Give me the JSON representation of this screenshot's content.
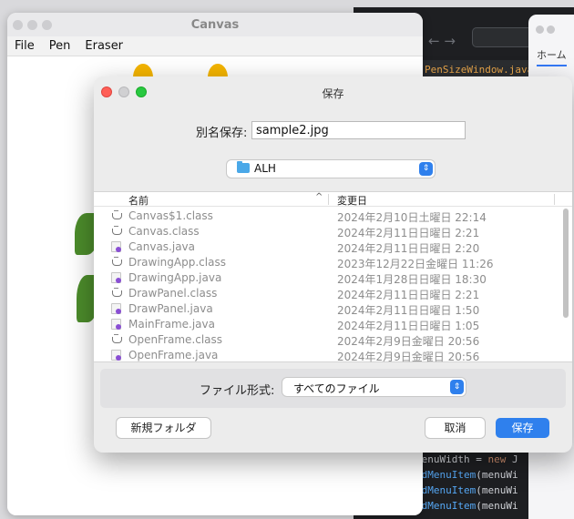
{
  "editor": {
    "nav_arrows": "← →",
    "tab_label": "PenSizeWindow.java",
    "code_lines": [
      {
        "a": "menuWidth = ",
        "kw": "new",
        "b": " J"
      },
      {
        "a": "",
        "m": "ddMenuItem",
        "b": "(menuWi"
      },
      {
        "a": "",
        "m": "ddMenuItem",
        "b": "(menuWi"
      },
      {
        "a": "",
        "m": "ddMenuItem",
        "b": "(menuWi"
      }
    ]
  },
  "right_window": {
    "tab_label": "ホーム"
  },
  "canvas_window": {
    "title": "Canvas",
    "menu": [
      "File",
      "Pen",
      "Eraser"
    ]
  },
  "dialog": {
    "title": "保存",
    "save_as_label": "別名保存:",
    "file_name": "sample2.jpg",
    "location": "ALH",
    "column_name": "名前",
    "sort_indicator": "^",
    "column_date": "変更日",
    "files": [
      {
        "name": "Canvas$1.class",
        "date": "2024年2月10日土曜日 22:14",
        "type": "class"
      },
      {
        "name": "Canvas.class",
        "date": "2024年2月11日日曜日 2:21",
        "type": "class"
      },
      {
        "name": "Canvas.java",
        "date": "2024年2月11日日曜日 2:20",
        "type": "java"
      },
      {
        "name": "DrawingApp.class",
        "date": "2023年12月22日金曜日 11:26",
        "type": "class"
      },
      {
        "name": "DrawingApp.java",
        "date": "2024年1月28日日曜日 18:30",
        "type": "java"
      },
      {
        "name": "DrawPanel.class",
        "date": "2024年2月11日日曜日 2:21",
        "type": "class"
      },
      {
        "name": "DrawPanel.java",
        "date": "2024年2月11日日曜日 1:50",
        "type": "java"
      },
      {
        "name": "MainFrame.java",
        "date": "2024年2月11日日曜日 1:05",
        "type": "java"
      },
      {
        "name": "OpenFrame.class",
        "date": "2024年2月9日金曜日 20:56",
        "type": "class"
      },
      {
        "name": "OpenFrame.java",
        "date": "2024年2月9日金曜日 20:56",
        "type": "java"
      }
    ],
    "format_label": "ファイル形式:",
    "format_value": "すべてのファイル",
    "new_folder_label": "新規フォルダ",
    "cancel_label": "取消",
    "save_label": "保存",
    "accent_color": "#2f80ed"
  }
}
